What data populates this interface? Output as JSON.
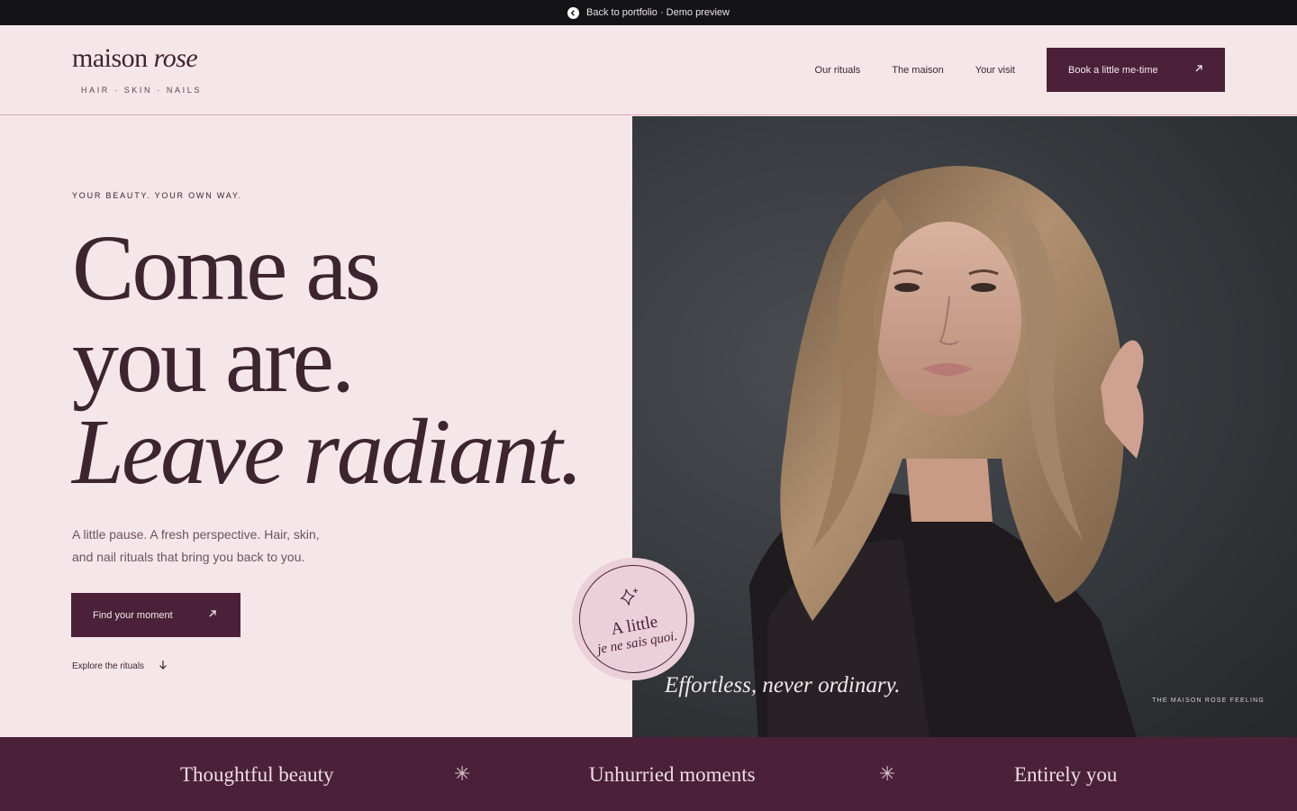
{
  "topbar": {
    "back_label": "Back to portfolio · Demo preview"
  },
  "brand": {
    "name_main": "maison",
    "name_accent": "rose",
    "tagline": "HAIR · SKIN · NAILS"
  },
  "nav": {
    "items": [
      {
        "label": "Our rituals"
      },
      {
        "label": "The maison"
      },
      {
        "label": "Your visit"
      }
    ],
    "cta_label": "Book a little me-time"
  },
  "hero": {
    "eyebrow": "YOUR BEAUTY. YOUR OWN WAY.",
    "headline_line1": "Come as",
    "headline_line2": "you are.",
    "headline_line3": "Leave radiant.",
    "lead": "A little pause. A fresh perspective. Hair, skin, and nail rituals that bring you back to you.",
    "primary_button": "Find your moment",
    "secondary_link": "Explore the rituals"
  },
  "badge": {
    "line1": "A little",
    "line2": "je ne sais quoi."
  },
  "photo": {
    "caption": "Effortless, never ordinary.",
    "credit": "THE MAISON ROSE FEELING"
  },
  "ribbon": {
    "items": [
      "Thoughtful beauty",
      "Unhurried moments",
      "Entirely you"
    ]
  },
  "colors": {
    "background": "#f5e6ea",
    "plum": "#4a2138",
    "text": "#3d2530",
    "badge": "#ebd0d9",
    "topbar": "#141416"
  },
  "icons": {
    "back": "chevron-left-circle-icon",
    "arrow": "arrow-up-right-icon",
    "down": "arrow-down-icon",
    "sparkle": "sparkle-icon",
    "separator": "asterisk-icon"
  }
}
